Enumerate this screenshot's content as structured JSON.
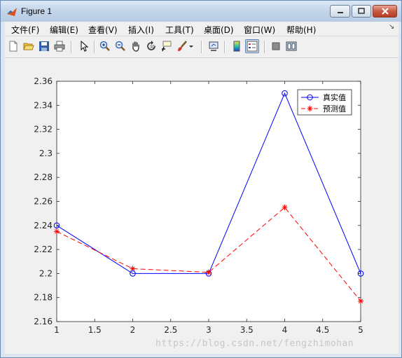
{
  "window": {
    "title": "Figure 1"
  },
  "menu": {
    "items": [
      "文件(F)",
      "编辑(E)",
      "查看(V)",
      "插入(I)",
      "工具(T)",
      "桌面(D)",
      "窗口(W)",
      "帮助(H)"
    ]
  },
  "toolbar": {
    "buttons": [
      "new-figure-icon",
      "open-file-icon",
      "save-icon",
      "print-icon",
      "pointer-icon",
      "zoom-in-icon",
      "zoom-out-icon",
      "pan-icon",
      "rotate-3d-icon",
      "data-cursor-icon",
      "brush-icon",
      "link-plot-icon",
      "colorbar-icon",
      "legend-icon",
      "hide-plot-tools-icon",
      "show-plot-tools-icon"
    ]
  },
  "chart_data": {
    "type": "line",
    "x": [
      1,
      2,
      3,
      4,
      5
    ],
    "series": [
      {
        "name": "真实值",
        "values": [
          2.24,
          2.2,
          2.2,
          2.35,
          2.2
        ],
        "color": "#0000ff",
        "marker": "circle",
        "line": "solid"
      },
      {
        "name": "预测值",
        "values": [
          2.235,
          2.204,
          2.201,
          2.255,
          2.177
        ],
        "color": "#ff0000",
        "marker": "asterisk",
        "line": "dashed"
      }
    ],
    "xlim": [
      1,
      5
    ],
    "ylim": [
      2.16,
      2.36
    ],
    "xticks": [
      "1",
      "1.5",
      "2",
      "2.5",
      "3",
      "3.5",
      "4",
      "4.5",
      "5"
    ],
    "yticks": [
      "2.16",
      "2.18",
      "2.2",
      "2.22",
      "2.24",
      "2.26",
      "2.28",
      "2.3",
      "2.32",
      "2.34",
      "2.36"
    ],
    "legend": "top-right",
    "grid": false
  },
  "watermark": "https://blog.csdn.net/fengzhimohan"
}
